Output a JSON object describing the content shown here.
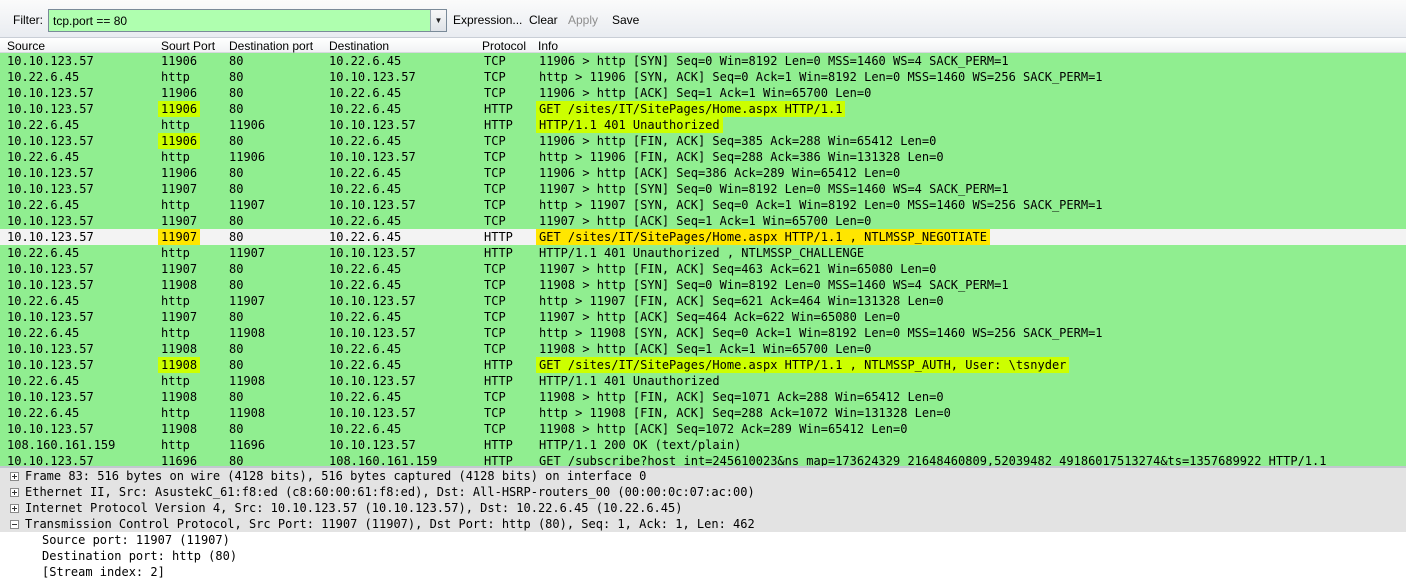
{
  "toolbar": {
    "filter_label": "Filter:",
    "filter_value": "tcp.port == 80",
    "filter_bg": "#afffaf",
    "dropdown_icon": "chevron-down-icon",
    "expression_label": "Expression...",
    "clear_label": "Clear",
    "apply_label": "Apply",
    "save_label": "Save"
  },
  "columns": {
    "source": "Source",
    "sport": "Sourt Port",
    "dport": "Destination port",
    "destination": "Destination",
    "protocol": "Protocol",
    "info": "Info"
  },
  "colors": {
    "tcp_row": "#90ee90",
    "selected_row": "#f3f3f3",
    "highlight_lime": "#ccff00",
    "highlight_yellow": "#ffe600"
  },
  "packets": [
    {
      "src": "10.10.123.57",
      "sport": "11906",
      "dport": "80",
      "dst": "10.22.6.45",
      "proto": "TCP",
      "info": "11906 > http [SYN] Seq=0 Win=8192 Len=0 MSS=1460 WS=4 SACK_PERM=1"
    },
    {
      "src": "10.22.6.45",
      "sport": "http",
      "dport": "80",
      "dst": "10.10.123.57",
      "proto": "TCP",
      "info": "http > 11906 [SYN, ACK] Seq=0 Ack=1 Win=8192 Len=0 MSS=1460 WS=256 SACK_PERM=1"
    },
    {
      "src": "10.10.123.57",
      "sport": "11906",
      "dport": "80",
      "dst": "10.22.6.45",
      "proto": "TCP",
      "info": "11906 > http [ACK] Seq=1 Ack=1 Win=65700 Len=0"
    },
    {
      "src": "10.10.123.57",
      "sport": "11906",
      "dport": "80",
      "dst": "10.22.6.45",
      "proto": "HTTP",
      "info": "GET /sites/IT/SitePages/Home.aspx HTTP/1.1"
    },
    {
      "src": "10.22.6.45",
      "sport": "http",
      "dport": "11906",
      "dst": "10.10.123.57",
      "proto": "HTTP",
      "info": "HTTP/1.1 401 Unauthorized"
    },
    {
      "src": "10.10.123.57",
      "sport": "11906",
      "dport": "80",
      "dst": "10.22.6.45",
      "proto": "TCP",
      "info": "11906 > http [FIN, ACK] Seq=385 Ack=288 Win=65412 Len=0"
    },
    {
      "src": "10.22.6.45",
      "sport": "http",
      "dport": "11906",
      "dst": "10.10.123.57",
      "proto": "TCP",
      "info": "http > 11906 [FIN, ACK] Seq=288 Ack=386 Win=131328 Len=0"
    },
    {
      "src": "10.10.123.57",
      "sport": "11906",
      "dport": "80",
      "dst": "10.22.6.45",
      "proto": "TCP",
      "info": "11906 > http [ACK] Seq=386 Ack=289 Win=65412 Len=0"
    },
    {
      "src": "10.10.123.57",
      "sport": "11907",
      "dport": "80",
      "dst": "10.22.6.45",
      "proto": "TCP",
      "info": "11907 > http [SYN] Seq=0 Win=8192 Len=0 MSS=1460 WS=4 SACK_PERM=1"
    },
    {
      "src": "10.22.6.45",
      "sport": "http",
      "dport": "11907",
      "dst": "10.10.123.57",
      "proto": "TCP",
      "info": "http > 11907 [SYN, ACK] Seq=0 Ack=1 Win=8192 Len=0 MSS=1460 WS=256 SACK_PERM=1"
    },
    {
      "src": "10.10.123.57",
      "sport": "11907",
      "dport": "80",
      "dst": "10.22.6.45",
      "proto": "TCP",
      "info": "11907 > http [ACK] Seq=1 Ack=1 Win=65700 Len=0"
    },
    {
      "src": "10.10.123.57",
      "sport": "11907",
      "dport": "80",
      "dst": "10.22.6.45",
      "proto": "HTTP",
      "info": "GET /sites/IT/SitePages/Home.aspx HTTP/1.1 , NTLMSSP_NEGOTIATE"
    },
    {
      "src": "10.22.6.45",
      "sport": "http",
      "dport": "11907",
      "dst": "10.10.123.57",
      "proto": "HTTP",
      "info": "HTTP/1.1 401 Unauthorized , NTLMSSP_CHALLENGE"
    },
    {
      "src": "10.10.123.57",
      "sport": "11907",
      "dport": "80",
      "dst": "10.22.6.45",
      "proto": "TCP",
      "info": "11907 > http [FIN, ACK] Seq=463 Ack=621 Win=65080 Len=0"
    },
    {
      "src": "10.10.123.57",
      "sport": "11908",
      "dport": "80",
      "dst": "10.22.6.45",
      "proto": "TCP",
      "info": "11908 > http [SYN] Seq=0 Win=8192 Len=0 MSS=1460 WS=4 SACK_PERM=1"
    },
    {
      "src": "10.22.6.45",
      "sport": "http",
      "dport": "11907",
      "dst": "10.10.123.57",
      "proto": "TCP",
      "info": "http > 11907 [FIN, ACK] Seq=621 Ack=464 Win=131328 Len=0"
    },
    {
      "src": "10.10.123.57",
      "sport": "11907",
      "dport": "80",
      "dst": "10.22.6.45",
      "proto": "TCP",
      "info": "11907 > http [ACK] Seq=464 Ack=622 Win=65080 Len=0"
    },
    {
      "src": "10.22.6.45",
      "sport": "http",
      "dport": "11908",
      "dst": "10.10.123.57",
      "proto": "TCP",
      "info": "http > 11908 [SYN, ACK] Seq=0 Ack=1 Win=8192 Len=0 MSS=1460 WS=256 SACK_PERM=1"
    },
    {
      "src": "10.10.123.57",
      "sport": "11908",
      "dport": "80",
      "dst": "10.22.6.45",
      "proto": "TCP",
      "info": "11908 > http [ACK] Seq=1 Ack=1 Win=65700 Len=0"
    },
    {
      "src": "10.10.123.57",
      "sport": "11908",
      "dport": "80",
      "dst": "10.22.6.45",
      "proto": "HTTP",
      "info": "GET /sites/IT/SitePages/Home.aspx HTTP/1.1 , NTLMSSP_AUTH, User: \\tsnyder"
    },
    {
      "src": "10.22.6.45",
      "sport": "http",
      "dport": "11908",
      "dst": "10.10.123.57",
      "proto": "HTTP",
      "info": "HTTP/1.1 401 Unauthorized"
    },
    {
      "src": "10.10.123.57",
      "sport": "11908",
      "dport": "80",
      "dst": "10.22.6.45",
      "proto": "TCP",
      "info": "11908 > http [FIN, ACK] Seq=1071 Ack=288 Win=65412 Len=0"
    },
    {
      "src": "10.22.6.45",
      "sport": "http",
      "dport": "11908",
      "dst": "10.10.123.57",
      "proto": "TCP",
      "info": "http > 11908 [FIN, ACK] Seq=288 Ack=1072 Win=131328 Len=0"
    },
    {
      "src": "10.10.123.57",
      "sport": "11908",
      "dport": "80",
      "dst": "10.22.6.45",
      "proto": "TCP",
      "info": "11908 > http [ACK] Seq=1072 Ack=289 Win=65412 Len=0"
    },
    {
      "src": "108.160.161.159",
      "sport": "http",
      "dport": "11696",
      "dst": "10.10.123.57",
      "proto": "HTTP",
      "info": "HTTP/1.1 200 OK  (text/plain)"
    },
    {
      "src": "10.10.123.57",
      "sport": "11696",
      "dport": "80",
      "dst": "108.160.161.159",
      "proto": "HTTP",
      "info": "GET /subscribe?host_int=245610023&ns_map=173624329_21648460809,52039482_49186017513274&ts=1357689922 HTTP/1.1"
    }
  ],
  "details": {
    "frame": "Frame 83: 516 bytes on wire (4128 bits), 516 bytes captured (4128 bits) on interface 0",
    "ethernet": "Ethernet II, Src: AsustekC_61:f8:ed (c8:60:00:61:f8:ed), Dst: All-HSRP-routers_00 (00:00:0c:07:ac:00)",
    "ip": "Internet Protocol Version 4, Src: 10.10.123.57 (10.10.123.57), Dst: 10.22.6.45 (10.22.6.45)",
    "tcp": "Transmission Control Protocol, Src Port: 11907 (11907), Dst Port: http (80), Seq: 1, Ack: 1, Len: 462",
    "tcp_source_port": "Source port: 11907 (11907)",
    "tcp_destination_port": "Destination port: http (80)",
    "tcp_stream_index": "[Stream index: 2]"
  }
}
